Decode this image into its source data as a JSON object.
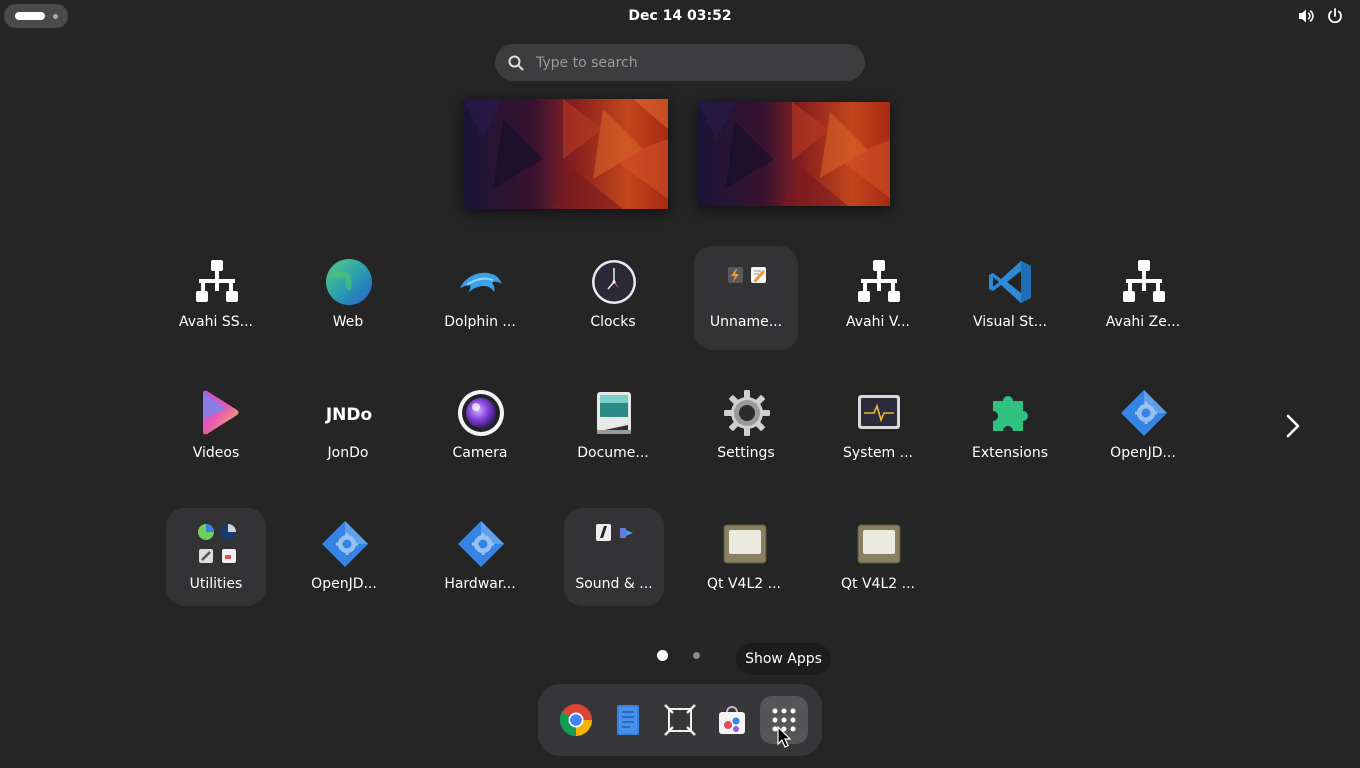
{
  "topbar": {
    "clock": "Dec 14  03:52",
    "icons": [
      "activities-indicator",
      "volume-icon",
      "power-icon"
    ]
  },
  "search": {
    "placeholder": "Type to search",
    "value": ""
  },
  "workspaces": [
    "workspace-1",
    "workspace-2"
  ],
  "apps": [
    {
      "label": "Avahi SS...",
      "icon": "network-icon"
    },
    {
      "label": "Web",
      "icon": "web-globe-icon"
    },
    {
      "label": "Dolphin ...",
      "icon": "dolphin-icon"
    },
    {
      "label": "Clocks",
      "icon": "clock-icon"
    },
    {
      "label": "Unname...",
      "icon": "folder-icon"
    },
    {
      "label": "Avahi V...",
      "icon": "network-icon"
    },
    {
      "label": "Visual St...",
      "icon": "vscode-icon"
    },
    {
      "label": "Avahi Ze...",
      "icon": "network-icon"
    },
    {
      "label": "Videos",
      "icon": "videos-icon"
    },
    {
      "label": "JonDo",
      "icon": "jondo-icon"
    },
    {
      "label": "Camera",
      "icon": "camera-icon"
    },
    {
      "label": "Docume...",
      "icon": "document-scanner-icon"
    },
    {
      "label": "Settings",
      "icon": "gear-icon"
    },
    {
      "label": "System ...",
      "icon": "system-monitor-icon"
    },
    {
      "label": "Extensions",
      "icon": "puzzle-icon"
    },
    {
      "label": "OpenJD...",
      "icon": "openjdk-icon"
    },
    {
      "label": "Utilities",
      "icon": "folder-icon"
    },
    {
      "label": "OpenJD...",
      "icon": "openjdk-icon"
    },
    {
      "label": "Hardwar...",
      "icon": "hardware-icon"
    },
    {
      "label": "Sound & ...",
      "icon": "folder-icon"
    },
    {
      "label": "Qt V4L2 ...",
      "icon": "qt-v4l2-icon"
    },
    {
      "label": "Qt V4L2 ...",
      "icon": "qt-v4l2-icon"
    }
  ],
  "jondo_text": "JNDo",
  "pager": {
    "pages": 2,
    "current": 1
  },
  "tooltip": "Show Apps",
  "dock": [
    {
      "name": "chrome-icon"
    },
    {
      "name": "text-editor-icon"
    },
    {
      "name": "screenshot-icon"
    },
    {
      "name": "software-store-icon"
    },
    {
      "name": "show-apps-icon"
    }
  ],
  "colors": {
    "background": "#252526",
    "search_bg": "#3d3d3f",
    "folder_bg": "#333335",
    "dock_bg": "#373739",
    "vscode_blue": "#2f89d6",
    "extensions_green": "#2ec27e",
    "openjdk_blue": "#3584e4"
  }
}
